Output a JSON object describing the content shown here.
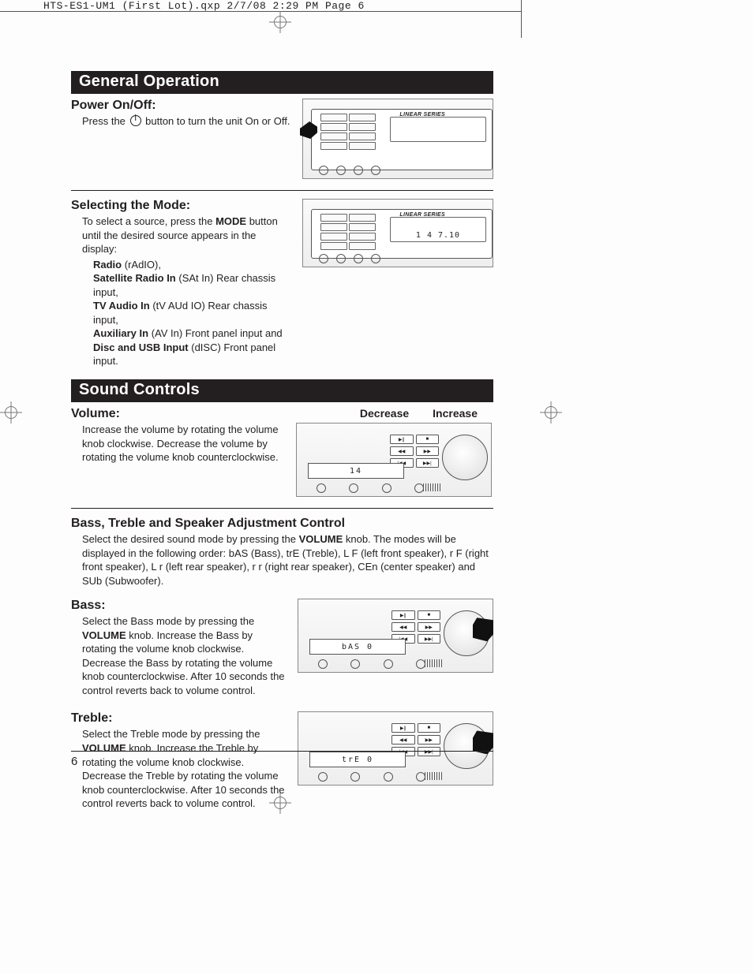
{
  "cropmark": {
    "text": "HTS-ES1-UM1 (First Lot).qxp  2/7/08  2:29 PM  Page 6"
  },
  "page_number": "6",
  "sections": {
    "general_operation": {
      "title": "General Operation",
      "power": {
        "heading": "Power On/Off:",
        "text_before_icon": "Press the ",
        "text_after_icon": " button to turn the unit On or Off.",
        "fig_brand": "LINEAR SERIES"
      },
      "mode": {
        "heading": "Selecting the Mode:",
        "intro_a": "To select a source, press the ",
        "intro_bold": "MODE",
        "intro_b": " button until the desired source appears in the display:",
        "items": [
          {
            "label": "Radio",
            "desc": " (rAdIO),"
          },
          {
            "label": "Satellite Radio In",
            "desc": " (SAt In) Rear chassis input,"
          },
          {
            "label": "TV Audio In",
            "desc": " (tV AUd IO) Rear chassis input,"
          },
          {
            "label": "Auxiliary In",
            "desc": " (AV In) Front panel input and"
          },
          {
            "label": "Disc and USB Input",
            "desc": " (dISC) Front panel input."
          }
        ],
        "fig_brand": "LINEAR SERIES",
        "fig_lcd": "  1 4   7.10"
      }
    },
    "sound_controls": {
      "title": "Sound Controls",
      "volume": {
        "heading": "Volume:",
        "text": "Increase the volume by rotating the volume knob clockwise. Decrease the volume by rotating the volume knob counterclockwise.",
        "label_decrease": "Decrease",
        "label_increase": "Increase",
        "fig_lcd": "14"
      },
      "bte": {
        "heading": "Bass, Treble and Speaker Adjustment Control",
        "text_a": "Select the desired sound mode by pressing the ",
        "text_bold": "VOLUME",
        "text_b": " knob. The modes will be displayed in the following order: bAS (Bass), trE (Treble), L F (left front speaker), r F (right front speaker), L r (left rear speaker), r r (right rear speaker), CEn (center speaker) and SUb (Subwoofer)."
      },
      "bass": {
        "heading": "Bass:",
        "text_a": "Select the Bass mode by pressing the ",
        "text_bold": "VOLUME",
        "text_b": " knob. Increase the Bass by rotating the volume knob clockwise. Decrease the Bass by rotating the volume knob counterclockwise. After 10 seconds the control reverts back to volume control.",
        "fig_lcd": "bAS    0"
      },
      "treble": {
        "heading": "Treble:",
        "text_a": "Select the Treble mode by pressing the ",
        "text_bold": "VOLUME",
        "text_b": " knob. Increase the Treble by rotating the volume knob clockwise. Decrease the Treble by rotating the volume knob counterclockwise. After 10 seconds the control reverts back to volume control.",
        "fig_lcd": "trE    0"
      }
    }
  }
}
